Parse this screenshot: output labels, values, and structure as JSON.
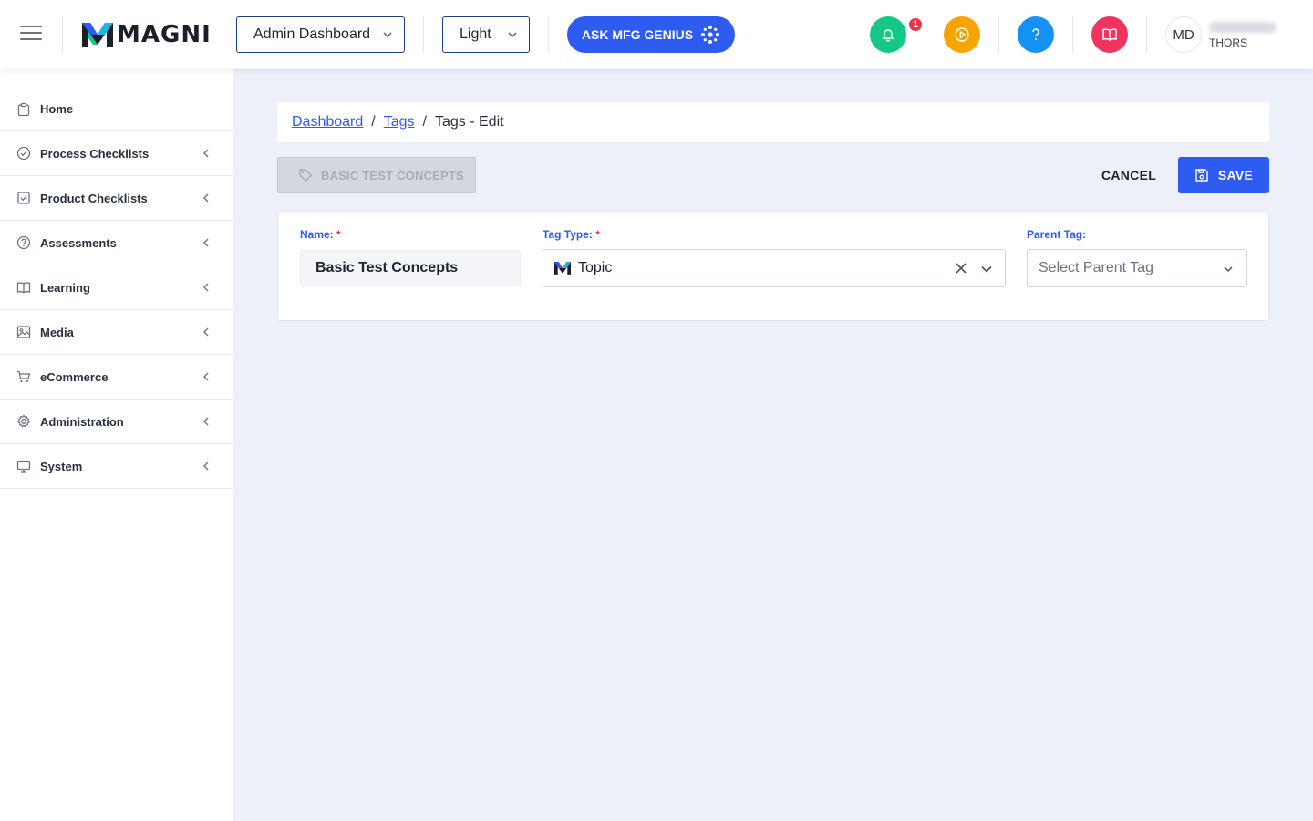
{
  "header": {
    "logo_text": "MAGNI",
    "dashboard_select": "Admin Dashboard",
    "theme_select": "Light",
    "ask_button": "ASK MFG GENIUS",
    "notification_count": "1",
    "avatar_initials": "MD",
    "user_org": "THORS"
  },
  "sidebar": {
    "items": [
      {
        "label": "Home",
        "icon": "clipboard-icon"
      },
      {
        "label": "Process Checklists",
        "icon": "check-circle-icon"
      },
      {
        "label": "Product Checklists",
        "icon": "check-square-icon"
      },
      {
        "label": "Assessments",
        "icon": "question-circle-icon"
      },
      {
        "label": "Learning",
        "icon": "book-icon"
      },
      {
        "label": "Media",
        "icon": "image-icon"
      },
      {
        "label": "eCommerce",
        "icon": "cart-icon"
      },
      {
        "label": "Administration",
        "icon": "gear-icon"
      },
      {
        "label": "System",
        "icon": "monitor-icon"
      }
    ]
  },
  "breadcrumb": {
    "dashboard": "Dashboard",
    "tags": "Tags",
    "current": "Tags - Edit",
    "separator": "/"
  },
  "toolbar": {
    "tag_chip": "BASIC TEST CONCEPTS",
    "cancel_label": "CANCEL",
    "save_label": "SAVE"
  },
  "form": {
    "name_label": "Name:",
    "name_value": "Basic Test Concepts",
    "tag_type_label": "Tag Type:",
    "tag_type_value": "Topic",
    "parent_tag_label": "Parent Tag:",
    "parent_tag_placeholder": "Select Parent Tag",
    "required_marker": "*"
  },
  "colors": {
    "primary": "#2f5cf0",
    "notify_green": "#14c784",
    "play_orange": "#f7a400",
    "help_blue": "#1590f5",
    "book_red": "#f0345e",
    "badge_red": "#ef3340"
  }
}
